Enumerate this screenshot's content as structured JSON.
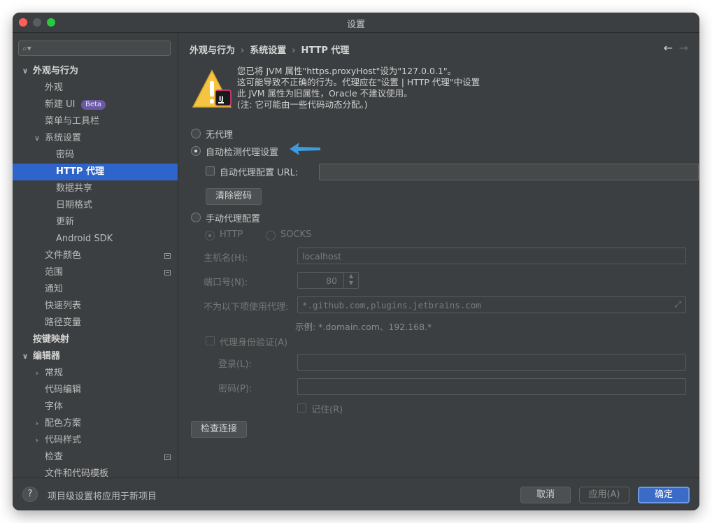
{
  "window": {
    "title": "设置"
  },
  "search": {
    "placeholder": ""
  },
  "sidebar": {
    "items": [
      {
        "label": "外观与行为",
        "arrow": "∨",
        "level": 0,
        "bold": true
      },
      {
        "label": "外观",
        "level": 1
      },
      {
        "label": "新建 UI",
        "level": 1,
        "badge": "Beta"
      },
      {
        "label": "菜单与工具栏",
        "level": 1
      },
      {
        "label": "系统设置",
        "arrow": "∨",
        "level": 1
      },
      {
        "label": "密码",
        "level": 2
      },
      {
        "label": "HTTP 代理",
        "level": 2,
        "selected": true
      },
      {
        "label": "数据共享",
        "level": 2
      },
      {
        "label": "日期格式",
        "level": 2
      },
      {
        "label": "更新",
        "level": 2
      },
      {
        "label": "Android SDK",
        "level": 2
      },
      {
        "label": "文件颜色",
        "level": 1,
        "project": true
      },
      {
        "label": "范围",
        "level": 1,
        "project": true
      },
      {
        "label": "通知",
        "level": 1
      },
      {
        "label": "快速列表",
        "level": 1
      },
      {
        "label": "路径变量",
        "level": 1
      },
      {
        "label": "按键映射",
        "level": 0,
        "bold": true
      },
      {
        "label": "编辑器",
        "arrow": "∨",
        "level": 0,
        "bold": true
      },
      {
        "label": "常规",
        "arrow": "›",
        "level": 1
      },
      {
        "label": "代码编辑",
        "level": 1
      },
      {
        "label": "字体",
        "level": 1
      },
      {
        "label": "配色方案",
        "arrow": "›",
        "level": 1
      },
      {
        "label": "代码样式",
        "arrow": "›",
        "level": 1
      },
      {
        "label": "检查",
        "level": 1,
        "project": true
      },
      {
        "label": "文件和代码模板",
        "level": 1
      }
    ]
  },
  "breadcrumb": {
    "part1": "外观与行为",
    "part2": "系统设置",
    "part3": "HTTP 代理",
    "sep": "›"
  },
  "nav": {
    "back": "←",
    "forward": "→"
  },
  "warning": {
    "badge": "IJ",
    "lines": [
      "您已将 JVM 属性\"https.proxyHost\"设为\"127.0.0.1\"。",
      "这可能导致不正确的行为。代理应在\"设置 | HTTP 代理\"中设置",
      "此 JVM 属性为旧属性，Oracle 不建议使用。",
      "(注: 它可能由一些代码动态分配。)"
    ]
  },
  "proxy": {
    "no_proxy": "无代理",
    "auto_detect": "自动检测代理设置",
    "auto_config_url_label": "自动代理配置 URL:",
    "auto_config_url_value": "",
    "clear_passwords": "清除密码",
    "manual": "手动代理配置",
    "http": "HTTP",
    "socks": "SOCKS",
    "host_label": "主机名(H):",
    "host_value": "localhost",
    "port_label": "端口号(N):",
    "port_value": "80",
    "no_proxy_for_label": "不为以下项使用代理:",
    "no_proxy_for_value": "*.github.com,plugins.jetbrains.com",
    "example": "示例: *.domain.com、192.168.*",
    "auth_label": "代理身份验证(A)",
    "login_label": "登录(L):",
    "password_label": "密码(P):",
    "remember_label": "记住(R)",
    "check_connection": "检查连接"
  },
  "footer": {
    "help": "?",
    "note": "项目级设置将应用于新项目",
    "cancel": "取消",
    "apply": "应用(A)",
    "ok": "确定"
  },
  "colors": {
    "selection": "#2f65ca",
    "background": "#3c3f41",
    "arrow_annotation": "#3d9be0",
    "warning_yellow": "#f5c542"
  }
}
